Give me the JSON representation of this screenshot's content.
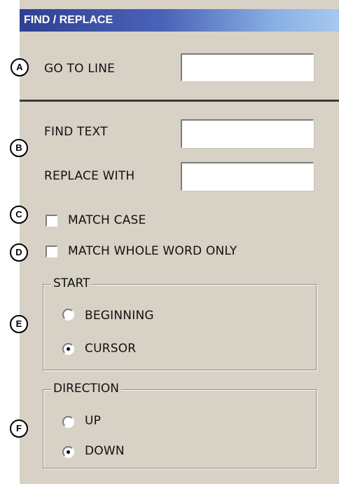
{
  "window": {
    "title": "FIND / REPLACE"
  },
  "badges": {
    "a": "A",
    "b": "B",
    "c": "C",
    "d": "D",
    "e": "E",
    "f": "F"
  },
  "goto": {
    "label": "GO TO LINE",
    "value": ""
  },
  "find": {
    "label": "FIND TEXT",
    "value": ""
  },
  "replace": {
    "label": "REPLACE WITH",
    "value": ""
  },
  "options": {
    "match_case": {
      "label": "MATCH CASE",
      "checked": false
    },
    "match_whole_word": {
      "label": "MATCH WHOLE WORD ONLY",
      "checked": false
    }
  },
  "start": {
    "legend": "START",
    "options": [
      {
        "label": "BEGINNING",
        "selected": false
      },
      {
        "label": "CURSOR",
        "selected": true
      }
    ]
  },
  "direction": {
    "legend": "DIRECTION",
    "options": [
      {
        "label": "UP",
        "selected": false
      },
      {
        "label": "DOWN",
        "selected": true
      }
    ]
  }
}
